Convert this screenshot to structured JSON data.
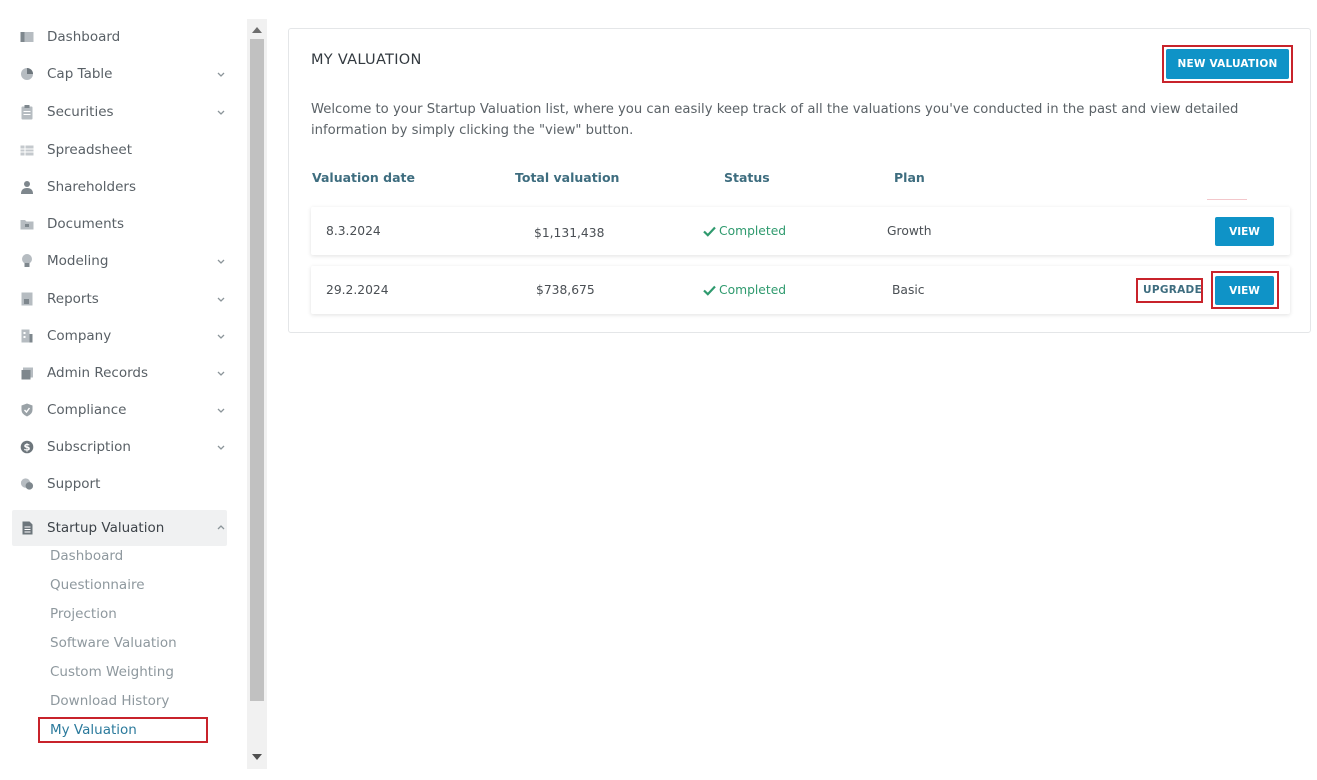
{
  "sidebar": {
    "items": [
      {
        "label": "Dashboard",
        "icon": "dashboard-icon",
        "chevron": false
      },
      {
        "label": "Cap Table",
        "icon": "pie-chart-icon",
        "chevron": true
      },
      {
        "label": "Securities",
        "icon": "clipboard-icon",
        "chevron": true
      },
      {
        "label": "Spreadsheet",
        "icon": "spreadsheet-icon",
        "chevron": false
      },
      {
        "label": "Shareholders",
        "icon": "user-icon",
        "chevron": false
      },
      {
        "label": "Documents",
        "icon": "folder-icon",
        "chevron": false
      },
      {
        "label": "Modeling",
        "icon": "lightbulb-icon",
        "chevron": true
      },
      {
        "label": "Reports",
        "icon": "report-icon",
        "chevron": true
      },
      {
        "label": "Company",
        "icon": "building-icon",
        "chevron": true
      },
      {
        "label": "Admin Records",
        "icon": "admin-records-icon",
        "chevron": true
      },
      {
        "label": "Compliance",
        "icon": "shield-check-icon",
        "chevron": true
      },
      {
        "label": "Subscription",
        "icon": "dollar-icon",
        "chevron": true
      },
      {
        "label": "Support",
        "icon": "support-icon",
        "chevron": false
      }
    ],
    "active_section": {
      "label": "Startup Valuation",
      "icon": "document-icon"
    },
    "sub_items": [
      "Dashboard",
      "Questionnaire",
      "Projection",
      "Software Valuation",
      "Custom Weighting",
      "Download History",
      "My Valuation"
    ]
  },
  "main": {
    "title": "MY VALUATION",
    "new_button": "NEW VALUATION",
    "intro": "Welcome to your Startup Valuation list, where you can easily keep track of all the valuations you've conducted in the past and view detailed information by simply clicking the \"view\" button.",
    "columns": [
      "Valuation date",
      "Total valuation",
      "Status",
      "Plan"
    ],
    "rows": [
      {
        "date": "8.3.2024",
        "total": "$1,131,438",
        "status": "Completed",
        "plan": "Growth",
        "upgrade": "",
        "view": "VIEW"
      },
      {
        "date": "29.2.2024",
        "total": "$738,675",
        "status": "Completed",
        "plan": "Basic",
        "upgrade": "UPGRADE",
        "view": "VIEW"
      }
    ]
  },
  "colors": {
    "accent": "#0f93c7",
    "status_green": "#2f9a6e",
    "highlight_red": "#c8232b",
    "header_text": "#3e6d7f"
  }
}
